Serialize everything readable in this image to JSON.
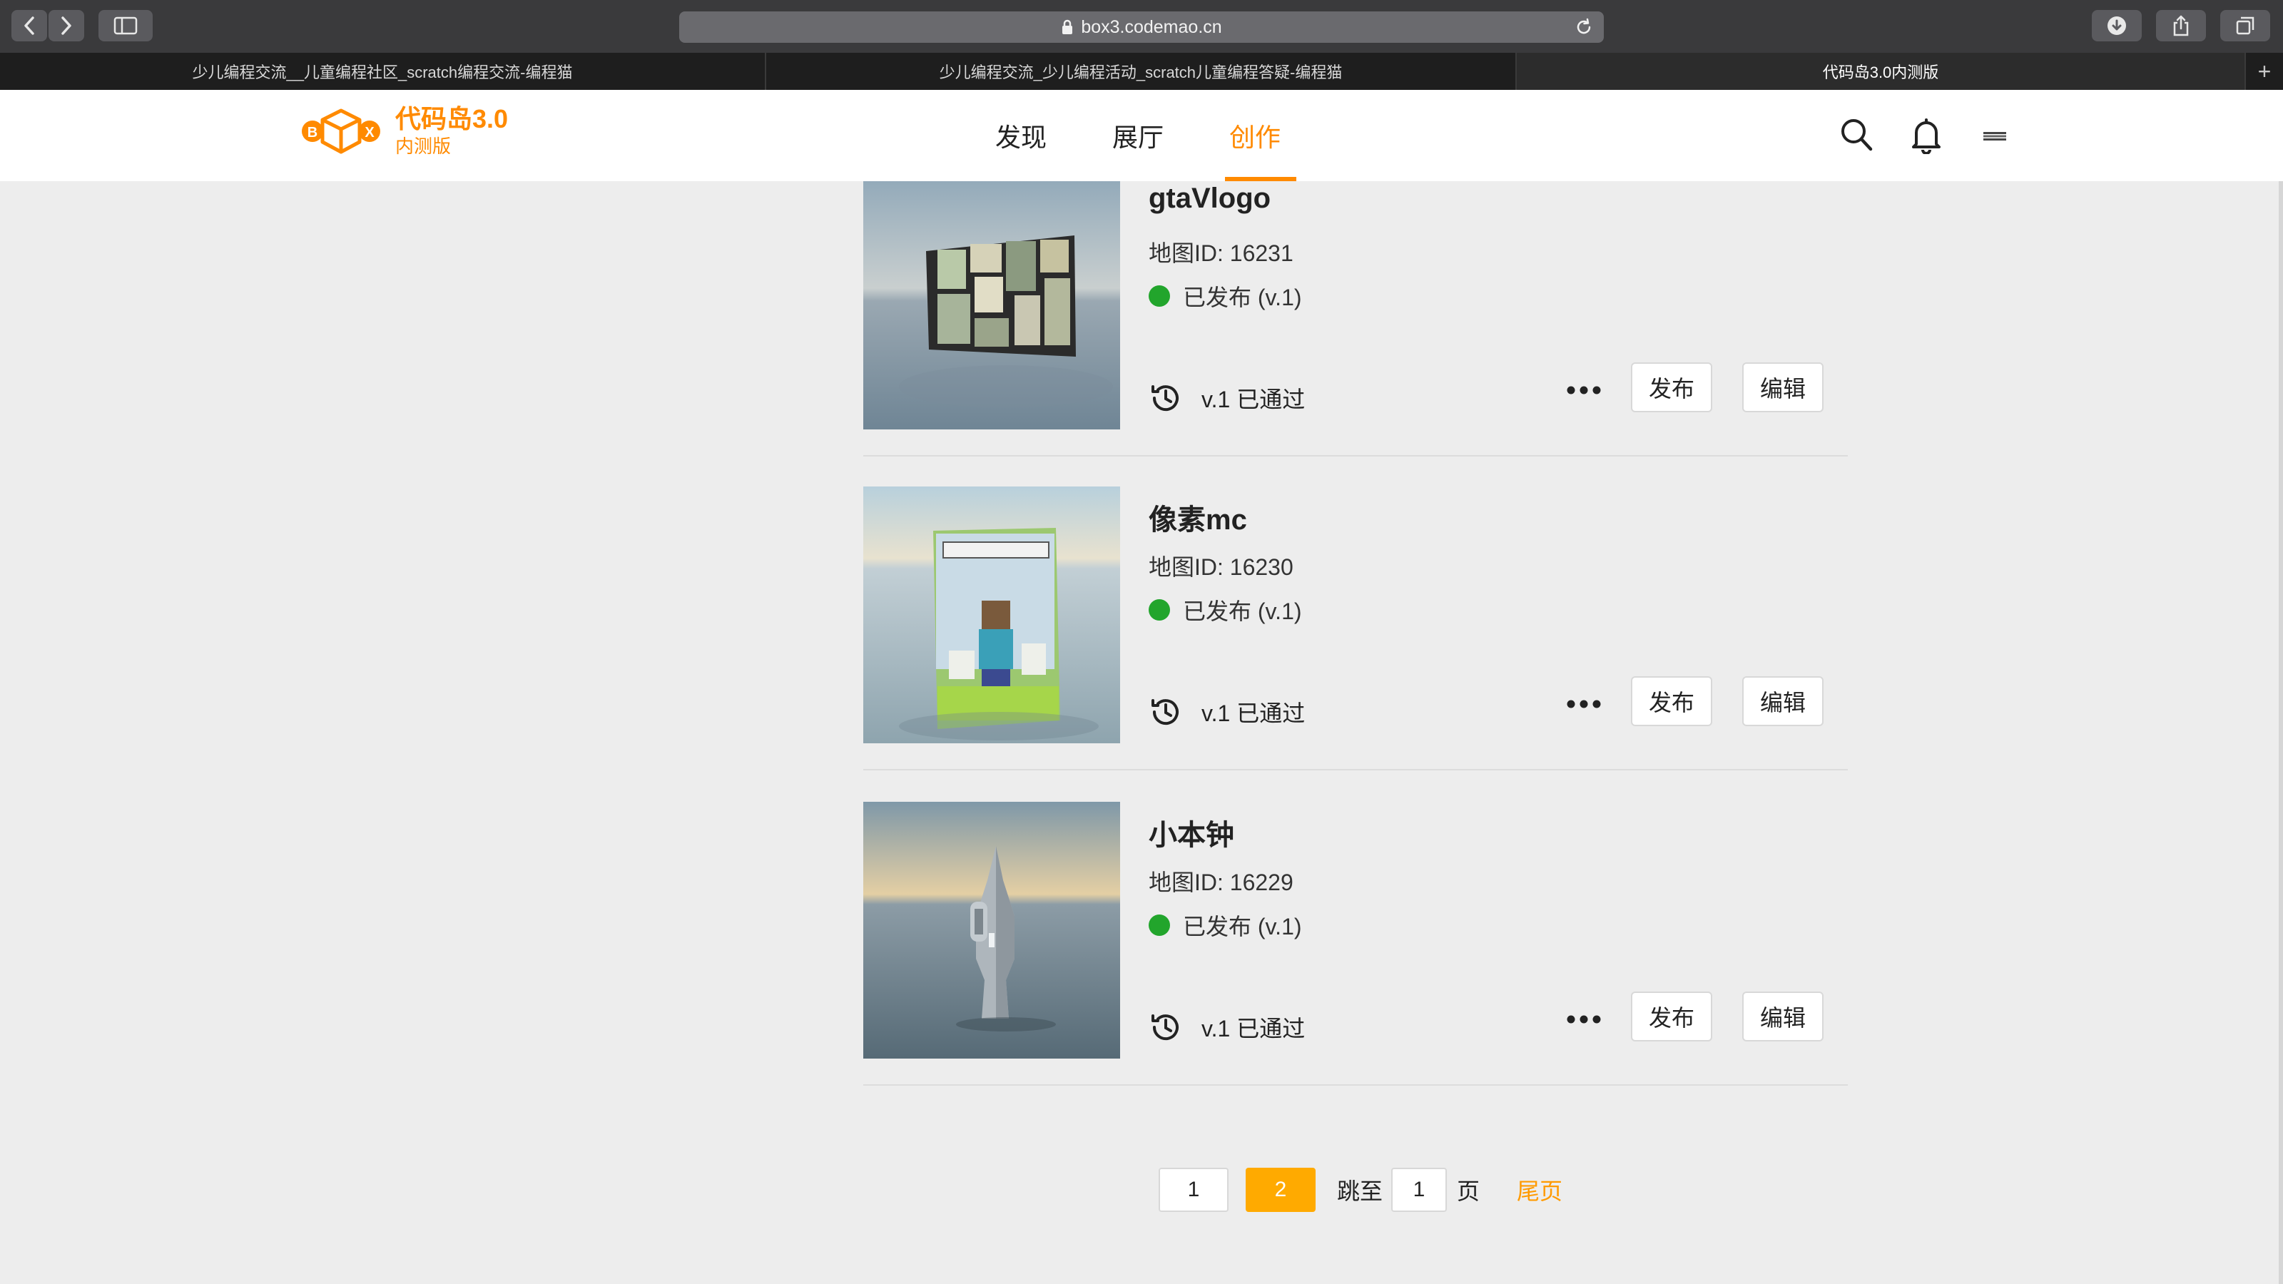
{
  "browser": {
    "url": "box3.codemao.cn",
    "tabs": [
      {
        "title": "少儿编程交流__儿童编程社区_scratch编程交流-编程猫",
        "active": false
      },
      {
        "title": "少儿编程交流_少儿编程活动_scratch儿童编程答疑-编程猫",
        "active": false
      },
      {
        "title": "代码岛3.0内测版",
        "active": true
      }
    ],
    "new_tab_symbol": "+"
  },
  "site": {
    "logo_letters": [
      "B",
      "X"
    ],
    "logo_title": "代码岛3.0",
    "logo_subtitle": "内测版",
    "nav": [
      {
        "label": "发现",
        "active": false
      },
      {
        "label": "展厅",
        "active": false
      },
      {
        "label": "创作",
        "active": true
      }
    ],
    "accent_color": "#ff8a00",
    "icons": [
      "search-icon",
      "bell-icon",
      "menu-icon"
    ]
  },
  "projects": [
    {
      "title": "gtaVlogo",
      "map_id": "地图ID: 16231",
      "status": "已发布 (v.1)",
      "version": "v.1 已通过",
      "publish_label": "发布",
      "edit_label": "编辑"
    },
    {
      "title": "像素mc",
      "map_id": "地图ID: 16230",
      "status": "已发布 (v.1)",
      "version": "v.1 已通过",
      "publish_label": "发布",
      "edit_label": "编辑"
    },
    {
      "title": "小本钟",
      "map_id": "地图ID: 16229",
      "status": "已发布 (v.1)",
      "version": "v.1 已通过",
      "publish_label": "发布",
      "edit_label": "编辑"
    }
  ],
  "status_color": "#22a52c",
  "pagination": {
    "pages": [
      "1",
      "2"
    ],
    "current": "2",
    "jump_label": "跳至",
    "jump_value": "1",
    "page_unit": "页",
    "last_label": "尾页",
    "active_color": "#ffaa00"
  }
}
